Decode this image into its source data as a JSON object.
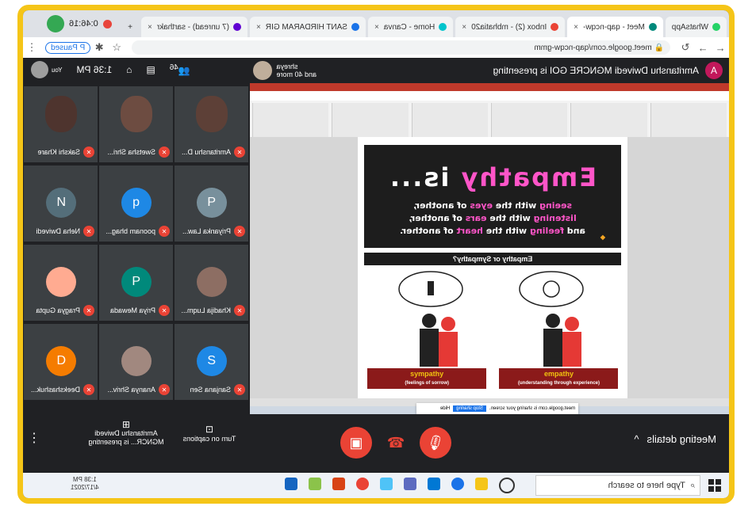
{
  "browser": {
    "tabs": [
      {
        "label": "WhatsApp",
        "color": "#25d366"
      },
      {
        "label": "Meet - qap-ncqw-",
        "color": "#00897b",
        "active": true
      },
      {
        "label": "Inbox (2) - mbhatia20",
        "color": "#ea4335"
      },
      {
        "label": "Home - Canva",
        "color": "#00c4cc"
      },
      {
        "label": "SANT HIRDARAM GIR",
        "color": "#1a73e8"
      },
      {
        "label": "(7 unread) - sarthakr",
        "color": "#6001d2"
      }
    ],
    "timer": "0:46:16",
    "url": "meet.google.com/qap-ncqw-gmm",
    "paused_label": "Paused",
    "profile_initial": "P"
  },
  "meet": {
    "presenter_avatar_initial": "A",
    "presenting_text": "Amritanshu Dwivedi MGNCRE GOI is presenting",
    "pinned_name": "shreya",
    "pinned_more": "and 40 more",
    "participant_count": "46",
    "clock": "1:36 PM",
    "self_label": "You"
  },
  "slide": {
    "title_a": "Em",
    "title_b": "pathy",
    "title_c": " is...",
    "line1_a": "seeing",
    "line1_b": " with the ",
    "line1_c": "eyes",
    "line1_d": " of another,",
    "line2_a": "listening",
    "line2_b": " with the ",
    "line2_c": "ears",
    "line2_d": " of another,",
    "line3_a": "and ",
    "line3_b": "feeling",
    "line3_c": " with the ",
    "line3_d": "heart",
    "line3_e": " of another.",
    "question": "Empathy or Sympathy?",
    "sympathy": "sympathy",
    "sympathy_sub": "(feelings of sorrow)",
    "empathy": "empathy",
    "empathy_sub": "(understanding through experience)",
    "sharing_text": "meet.google.com is sharing your screen.",
    "stop_sharing": "Stop sharing",
    "hide": "Hide"
  },
  "participants": [
    {
      "name": "Amritanshu D...",
      "type": "video",
      "bg": "#5d4037"
    },
    {
      "name": "Swetsha Shri...",
      "type": "video",
      "bg": "#6d4c41"
    },
    {
      "name": "Sakshi Khare",
      "type": "video",
      "bg": "#4e342e"
    },
    {
      "name": "Priyanka Law...",
      "type": "initial",
      "initial": "P",
      "color": "#78909c"
    },
    {
      "name": "poonam bhag...",
      "type": "initial",
      "initial": "p",
      "color": "#1e88e5"
    },
    {
      "name": "Neha Dwivedi",
      "type": "initial",
      "initial": "N",
      "color": "#546e7a"
    },
    {
      "name": "Khadija Luqm...",
      "type": "photo",
      "color": "#8d6e63"
    },
    {
      "name": "Priya Mewada",
      "type": "initial",
      "initial": "P",
      "color": "#00897b"
    },
    {
      "name": "Pragya Gupta",
      "type": "photo",
      "color": "#ffab91"
    },
    {
      "name": "Sanjana Sen",
      "type": "initial",
      "initial": "S",
      "color": "#1e88e5"
    },
    {
      "name": "Ananya Shriv...",
      "type": "photo",
      "color": "#a1887f"
    },
    {
      "name": "Deekshashuk...",
      "type": "initial",
      "initial": "D",
      "color": "#f57c00"
    }
  ],
  "bottom": {
    "meeting_details": "Meeting details",
    "captions": "Turn on captions",
    "presenting": "Amritanshu Dwivedi MGNCR... is presenting"
  },
  "taskbar": {
    "search": "Type here to search",
    "time": "1:38 PM",
    "date": "4/17/2021"
  }
}
